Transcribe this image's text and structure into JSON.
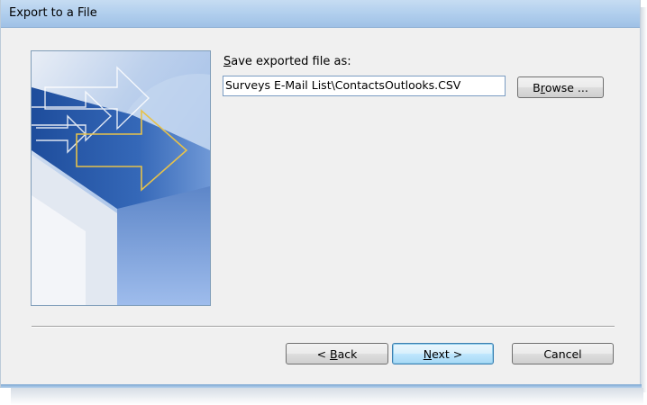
{
  "window": {
    "title": "Export to a File"
  },
  "file": {
    "label_accel": "S",
    "label_rest": "ave exported file as:",
    "path_value": "Surveys E-Mail List\\ContactsOutlooks.CSV",
    "browse_accel": "r",
    "browse_pre": "B",
    "browse_post": "owse ..."
  },
  "buttons": {
    "back_pre": "< ",
    "back_accel": "B",
    "back_post": "ack",
    "next_accel": "N",
    "next_post": "ext >",
    "cancel": "Cancel"
  },
  "colors": {
    "titlebar": "#b3d0ee",
    "dialog": "#f0f0f0",
    "accent": "#3c7fb1"
  },
  "icons": {
    "wizard_picture": "export-wizard-arrows-image"
  }
}
